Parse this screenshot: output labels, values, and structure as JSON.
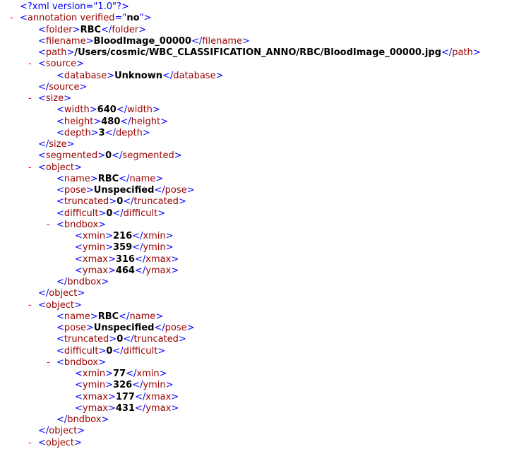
{
  "lines": [
    {
      "indent": 0,
      "toggle": "",
      "parts": [
        {
          "t": "<?",
          "c": "b"
        },
        {
          "t": "xml version=\"1.0\"",
          "c": "b"
        },
        {
          "t": "?>",
          "c": "b"
        }
      ]
    },
    {
      "indent": 0,
      "toggle": "-",
      "parts": [
        {
          "t": "<",
          "c": "b"
        },
        {
          "t": "annotation",
          "c": "m"
        },
        {
          "t": " verified",
          "c": "m"
        },
        {
          "t": "=\"",
          "c": "b"
        },
        {
          "t": "no",
          "c": "t"
        },
        {
          "t": "\">",
          "c": "b"
        }
      ]
    },
    {
      "indent": 1,
      "toggle": "",
      "parts": [
        {
          "t": "<",
          "c": "b"
        },
        {
          "t": "folder",
          "c": "m"
        },
        {
          "t": ">",
          "c": "b"
        },
        {
          "t": "RBC",
          "c": "t"
        },
        {
          "t": "</",
          "c": "b"
        },
        {
          "t": "folder",
          "c": "m"
        },
        {
          "t": ">",
          "c": "b"
        }
      ]
    },
    {
      "indent": 1,
      "toggle": "",
      "parts": [
        {
          "t": "<",
          "c": "b"
        },
        {
          "t": "filename",
          "c": "m"
        },
        {
          "t": ">",
          "c": "b"
        },
        {
          "t": "BloodImage_00000",
          "c": "t"
        },
        {
          "t": "</",
          "c": "b"
        },
        {
          "t": "filename",
          "c": "m"
        },
        {
          "t": ">",
          "c": "b"
        }
      ]
    },
    {
      "indent": 1,
      "toggle": "",
      "parts": [
        {
          "t": "<",
          "c": "b"
        },
        {
          "t": "path",
          "c": "m"
        },
        {
          "t": ">",
          "c": "b"
        },
        {
          "t": "/Users/cosmic/WBC_CLASSIFICATION_ANNO/RBC/BloodImage_00000.jpg",
          "c": "t"
        },
        {
          "t": "</",
          "c": "b"
        },
        {
          "t": "path",
          "c": "m"
        },
        {
          "t": ">",
          "c": "b"
        }
      ]
    },
    {
      "indent": 1,
      "toggle": "-",
      "parts": [
        {
          "t": "<",
          "c": "b"
        },
        {
          "t": "source",
          "c": "m"
        },
        {
          "t": ">",
          "c": "b"
        }
      ]
    },
    {
      "indent": 2,
      "toggle": "",
      "parts": [
        {
          "t": "<",
          "c": "b"
        },
        {
          "t": "database",
          "c": "m"
        },
        {
          "t": ">",
          "c": "b"
        },
        {
          "t": "Unknown",
          "c": "t"
        },
        {
          "t": "</",
          "c": "b"
        },
        {
          "t": "database",
          "c": "m"
        },
        {
          "t": ">",
          "c": "b"
        }
      ]
    },
    {
      "indent": 1,
      "toggle": "",
      "parts": [
        {
          "t": "</",
          "c": "b"
        },
        {
          "t": "source",
          "c": "m"
        },
        {
          "t": ">",
          "c": "b"
        }
      ]
    },
    {
      "indent": 1,
      "toggle": "-",
      "parts": [
        {
          "t": "<",
          "c": "b"
        },
        {
          "t": "size",
          "c": "m"
        },
        {
          "t": ">",
          "c": "b"
        }
      ]
    },
    {
      "indent": 2,
      "toggle": "",
      "parts": [
        {
          "t": "<",
          "c": "b"
        },
        {
          "t": "width",
          "c": "m"
        },
        {
          "t": ">",
          "c": "b"
        },
        {
          "t": "640",
          "c": "t"
        },
        {
          "t": "</",
          "c": "b"
        },
        {
          "t": "width",
          "c": "m"
        },
        {
          "t": ">",
          "c": "b"
        }
      ]
    },
    {
      "indent": 2,
      "toggle": "",
      "parts": [
        {
          "t": "<",
          "c": "b"
        },
        {
          "t": "height",
          "c": "m"
        },
        {
          "t": ">",
          "c": "b"
        },
        {
          "t": "480",
          "c": "t"
        },
        {
          "t": "</",
          "c": "b"
        },
        {
          "t": "height",
          "c": "m"
        },
        {
          "t": ">",
          "c": "b"
        }
      ]
    },
    {
      "indent": 2,
      "toggle": "",
      "parts": [
        {
          "t": "<",
          "c": "b"
        },
        {
          "t": "depth",
          "c": "m"
        },
        {
          "t": ">",
          "c": "b"
        },
        {
          "t": "3",
          "c": "t"
        },
        {
          "t": "</",
          "c": "b"
        },
        {
          "t": "depth",
          "c": "m"
        },
        {
          "t": ">",
          "c": "b"
        }
      ]
    },
    {
      "indent": 1,
      "toggle": "",
      "parts": [
        {
          "t": "</",
          "c": "b"
        },
        {
          "t": "size",
          "c": "m"
        },
        {
          "t": ">",
          "c": "b"
        }
      ]
    },
    {
      "indent": 1,
      "toggle": "",
      "parts": [
        {
          "t": "<",
          "c": "b"
        },
        {
          "t": "segmented",
          "c": "m"
        },
        {
          "t": ">",
          "c": "b"
        },
        {
          "t": "0",
          "c": "t"
        },
        {
          "t": "</",
          "c": "b"
        },
        {
          "t": "segmented",
          "c": "m"
        },
        {
          "t": ">",
          "c": "b"
        }
      ]
    },
    {
      "indent": 1,
      "toggle": "-",
      "parts": [
        {
          "t": "<",
          "c": "b"
        },
        {
          "t": "object",
          "c": "m"
        },
        {
          "t": ">",
          "c": "b"
        }
      ]
    },
    {
      "indent": 2,
      "toggle": "",
      "parts": [
        {
          "t": "<",
          "c": "b"
        },
        {
          "t": "name",
          "c": "m"
        },
        {
          "t": ">",
          "c": "b"
        },
        {
          "t": "RBC",
          "c": "t"
        },
        {
          "t": "</",
          "c": "b"
        },
        {
          "t": "name",
          "c": "m"
        },
        {
          "t": ">",
          "c": "b"
        }
      ]
    },
    {
      "indent": 2,
      "toggle": "",
      "parts": [
        {
          "t": "<",
          "c": "b"
        },
        {
          "t": "pose",
          "c": "m"
        },
        {
          "t": ">",
          "c": "b"
        },
        {
          "t": "Unspecified",
          "c": "t"
        },
        {
          "t": "</",
          "c": "b"
        },
        {
          "t": "pose",
          "c": "m"
        },
        {
          "t": ">",
          "c": "b"
        }
      ]
    },
    {
      "indent": 2,
      "toggle": "",
      "parts": [
        {
          "t": "<",
          "c": "b"
        },
        {
          "t": "truncated",
          "c": "m"
        },
        {
          "t": ">",
          "c": "b"
        },
        {
          "t": "0",
          "c": "t"
        },
        {
          "t": "</",
          "c": "b"
        },
        {
          "t": "truncated",
          "c": "m"
        },
        {
          "t": ">",
          "c": "b"
        }
      ]
    },
    {
      "indent": 2,
      "toggle": "",
      "parts": [
        {
          "t": "<",
          "c": "b"
        },
        {
          "t": "difficult",
          "c": "m"
        },
        {
          "t": ">",
          "c": "b"
        },
        {
          "t": "0",
          "c": "t"
        },
        {
          "t": "</",
          "c": "b"
        },
        {
          "t": "difficult",
          "c": "m"
        },
        {
          "t": ">",
          "c": "b"
        }
      ]
    },
    {
      "indent": 2,
      "toggle": "-",
      "parts": [
        {
          "t": "<",
          "c": "b"
        },
        {
          "t": "bndbox",
          "c": "m"
        },
        {
          "t": ">",
          "c": "b"
        }
      ]
    },
    {
      "indent": 3,
      "toggle": "",
      "parts": [
        {
          "t": "<",
          "c": "b"
        },
        {
          "t": "xmin",
          "c": "m"
        },
        {
          "t": ">",
          "c": "b"
        },
        {
          "t": "216",
          "c": "t"
        },
        {
          "t": "</",
          "c": "b"
        },
        {
          "t": "xmin",
          "c": "m"
        },
        {
          "t": ">",
          "c": "b"
        }
      ]
    },
    {
      "indent": 3,
      "toggle": "",
      "parts": [
        {
          "t": "<",
          "c": "b"
        },
        {
          "t": "ymin",
          "c": "m"
        },
        {
          "t": ">",
          "c": "b"
        },
        {
          "t": "359",
          "c": "t"
        },
        {
          "t": "</",
          "c": "b"
        },
        {
          "t": "ymin",
          "c": "m"
        },
        {
          "t": ">",
          "c": "b"
        }
      ]
    },
    {
      "indent": 3,
      "toggle": "",
      "parts": [
        {
          "t": "<",
          "c": "b"
        },
        {
          "t": "xmax",
          "c": "m"
        },
        {
          "t": ">",
          "c": "b"
        },
        {
          "t": "316",
          "c": "t"
        },
        {
          "t": "</",
          "c": "b"
        },
        {
          "t": "xmax",
          "c": "m"
        },
        {
          "t": ">",
          "c": "b"
        }
      ]
    },
    {
      "indent": 3,
      "toggle": "",
      "parts": [
        {
          "t": "<",
          "c": "b"
        },
        {
          "t": "ymax",
          "c": "m"
        },
        {
          "t": ">",
          "c": "b"
        },
        {
          "t": "464",
          "c": "t"
        },
        {
          "t": "</",
          "c": "b"
        },
        {
          "t": "ymax",
          "c": "m"
        },
        {
          "t": ">",
          "c": "b"
        }
      ]
    },
    {
      "indent": 2,
      "toggle": "",
      "parts": [
        {
          "t": "</",
          "c": "b"
        },
        {
          "t": "bndbox",
          "c": "m"
        },
        {
          "t": ">",
          "c": "b"
        }
      ]
    },
    {
      "indent": 1,
      "toggle": "",
      "parts": [
        {
          "t": "</",
          "c": "b"
        },
        {
          "t": "object",
          "c": "m"
        },
        {
          "t": ">",
          "c": "b"
        }
      ]
    },
    {
      "indent": 1,
      "toggle": "-",
      "parts": [
        {
          "t": "<",
          "c": "b"
        },
        {
          "t": "object",
          "c": "m"
        },
        {
          "t": ">",
          "c": "b"
        }
      ]
    },
    {
      "indent": 2,
      "toggle": "",
      "parts": [
        {
          "t": "<",
          "c": "b"
        },
        {
          "t": "name",
          "c": "m"
        },
        {
          "t": ">",
          "c": "b"
        },
        {
          "t": "RBC",
          "c": "t"
        },
        {
          "t": "</",
          "c": "b"
        },
        {
          "t": "name",
          "c": "m"
        },
        {
          "t": ">",
          "c": "b"
        }
      ]
    },
    {
      "indent": 2,
      "toggle": "",
      "parts": [
        {
          "t": "<",
          "c": "b"
        },
        {
          "t": "pose",
          "c": "m"
        },
        {
          "t": ">",
          "c": "b"
        },
        {
          "t": "Unspecified",
          "c": "t"
        },
        {
          "t": "</",
          "c": "b"
        },
        {
          "t": "pose",
          "c": "m"
        },
        {
          "t": ">",
          "c": "b"
        }
      ]
    },
    {
      "indent": 2,
      "toggle": "",
      "parts": [
        {
          "t": "<",
          "c": "b"
        },
        {
          "t": "truncated",
          "c": "m"
        },
        {
          "t": ">",
          "c": "b"
        },
        {
          "t": "0",
          "c": "t"
        },
        {
          "t": "</",
          "c": "b"
        },
        {
          "t": "truncated",
          "c": "m"
        },
        {
          "t": ">",
          "c": "b"
        }
      ]
    },
    {
      "indent": 2,
      "toggle": "",
      "parts": [
        {
          "t": "<",
          "c": "b"
        },
        {
          "t": "difficult",
          "c": "m"
        },
        {
          "t": ">",
          "c": "b"
        },
        {
          "t": "0",
          "c": "t"
        },
        {
          "t": "</",
          "c": "b"
        },
        {
          "t": "difficult",
          "c": "m"
        },
        {
          "t": ">",
          "c": "b"
        }
      ]
    },
    {
      "indent": 2,
      "toggle": "-",
      "parts": [
        {
          "t": "<",
          "c": "b"
        },
        {
          "t": "bndbox",
          "c": "m"
        },
        {
          "t": ">",
          "c": "b"
        }
      ]
    },
    {
      "indent": 3,
      "toggle": "",
      "parts": [
        {
          "t": "<",
          "c": "b"
        },
        {
          "t": "xmin",
          "c": "m"
        },
        {
          "t": ">",
          "c": "b"
        },
        {
          "t": "77",
          "c": "t"
        },
        {
          "t": "</",
          "c": "b"
        },
        {
          "t": "xmin",
          "c": "m"
        },
        {
          "t": ">",
          "c": "b"
        }
      ]
    },
    {
      "indent": 3,
      "toggle": "",
      "parts": [
        {
          "t": "<",
          "c": "b"
        },
        {
          "t": "ymin",
          "c": "m"
        },
        {
          "t": ">",
          "c": "b"
        },
        {
          "t": "326",
          "c": "t"
        },
        {
          "t": "</",
          "c": "b"
        },
        {
          "t": "ymin",
          "c": "m"
        },
        {
          "t": ">",
          "c": "b"
        }
      ]
    },
    {
      "indent": 3,
      "toggle": "",
      "parts": [
        {
          "t": "<",
          "c": "b"
        },
        {
          "t": "xmax",
          "c": "m"
        },
        {
          "t": ">",
          "c": "b"
        },
        {
          "t": "177",
          "c": "t"
        },
        {
          "t": "</",
          "c": "b"
        },
        {
          "t": "xmax",
          "c": "m"
        },
        {
          "t": ">",
          "c": "b"
        }
      ]
    },
    {
      "indent": 3,
      "toggle": "",
      "parts": [
        {
          "t": "<",
          "c": "b"
        },
        {
          "t": "ymax",
          "c": "m"
        },
        {
          "t": ">",
          "c": "b"
        },
        {
          "t": "431",
          "c": "t"
        },
        {
          "t": "</",
          "c": "b"
        },
        {
          "t": "ymax",
          "c": "m"
        },
        {
          "t": ">",
          "c": "b"
        }
      ]
    },
    {
      "indent": 2,
      "toggle": "",
      "parts": [
        {
          "t": "</",
          "c": "b"
        },
        {
          "t": "bndbox",
          "c": "m"
        },
        {
          "t": ">",
          "c": "b"
        }
      ]
    },
    {
      "indent": 1,
      "toggle": "",
      "parts": [
        {
          "t": "</",
          "c": "b"
        },
        {
          "t": "object",
          "c": "m"
        },
        {
          "t": ">",
          "c": "b"
        }
      ]
    },
    {
      "indent": 1,
      "toggle": "-",
      "parts": [
        {
          "t": "<",
          "c": "b"
        },
        {
          "t": "object",
          "c": "m"
        },
        {
          "t": ">",
          "c": "b"
        }
      ]
    }
  ]
}
